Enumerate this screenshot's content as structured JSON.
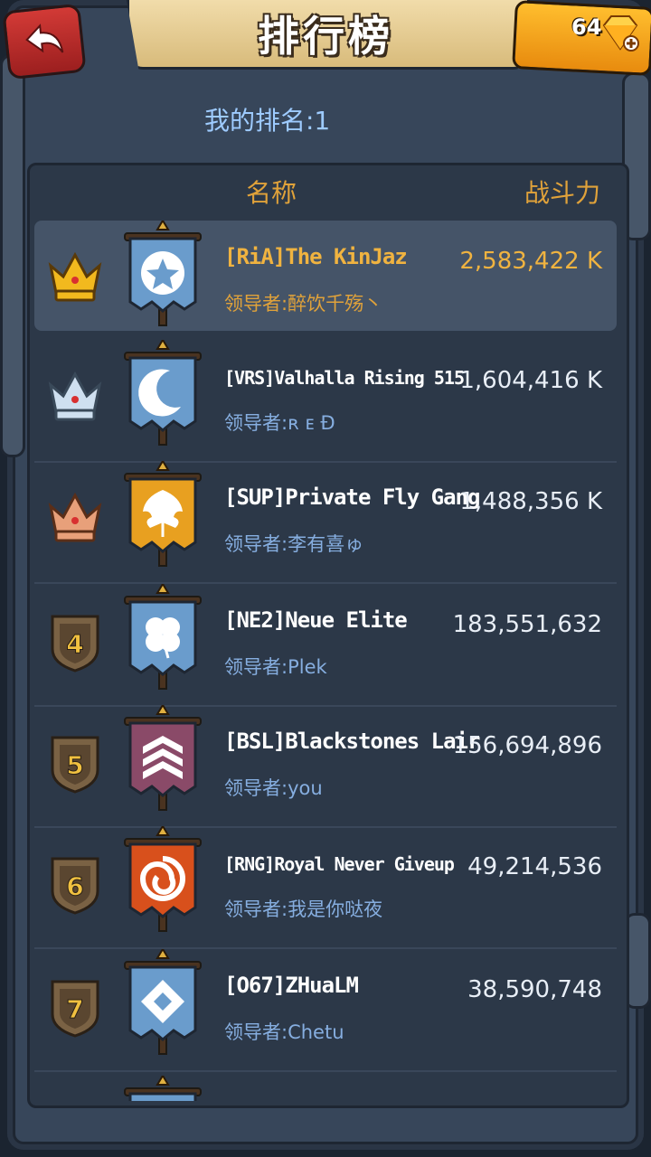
{
  "header": {
    "title": "排行榜",
    "gems": "64"
  },
  "my_rank": "我的排名:1",
  "columns": {
    "name": "名称",
    "power": "战斗力"
  },
  "rows": [
    {
      "rank": "1",
      "badge": "gold-crown",
      "banner_color": "#6a9ccc",
      "emblem": "star",
      "name": "[RiA]The KinJaz",
      "leader": "领导者:醉饮千殇丶",
      "power": "2,583,422 K"
    },
    {
      "rank": "2",
      "badge": "silver-crown",
      "banner_color": "#6a9ccc",
      "emblem": "moon",
      "name": "[VRS]Valhalla Rising 515",
      "leader": "领导者:ʀ ᴇ Đ",
      "power": "1,604,416 K"
    },
    {
      "rank": "3",
      "badge": "bronze-crown",
      "banner_color": "#e8a020",
      "emblem": "leaf",
      "name": "[SUP]Private Fly Gang",
      "leader": "领导者:李有喜ゅ",
      "power": "1,488,356 K"
    },
    {
      "rank": "4",
      "badge": "shield",
      "banner_color": "#6a9ccc",
      "emblem": "clover",
      "name": "[NE2]Neue Elite",
      "leader": "领导者:Plek",
      "power": "183,551,632"
    },
    {
      "rank": "5",
      "badge": "shield",
      "banner_color": "#8a4a68",
      "emblem": "chevrons",
      "name": "[BSL]Blackstones Lair",
      "leader": "领导者:you",
      "power": "156,694,896"
    },
    {
      "rank": "6",
      "badge": "shield",
      "banner_color": "#d8501c",
      "emblem": "spiral",
      "name": "[RNG]Royal Never Giveup",
      "leader": "领导者:我是你哒夜",
      "power": "49,214,536"
    },
    {
      "rank": "7",
      "badge": "shield",
      "banner_color": "#6a9ccc",
      "emblem": "diamond",
      "name": "[O67]ZHuaLM",
      "leader": "领导者:Chetu",
      "power": "38,590,748"
    }
  ]
}
